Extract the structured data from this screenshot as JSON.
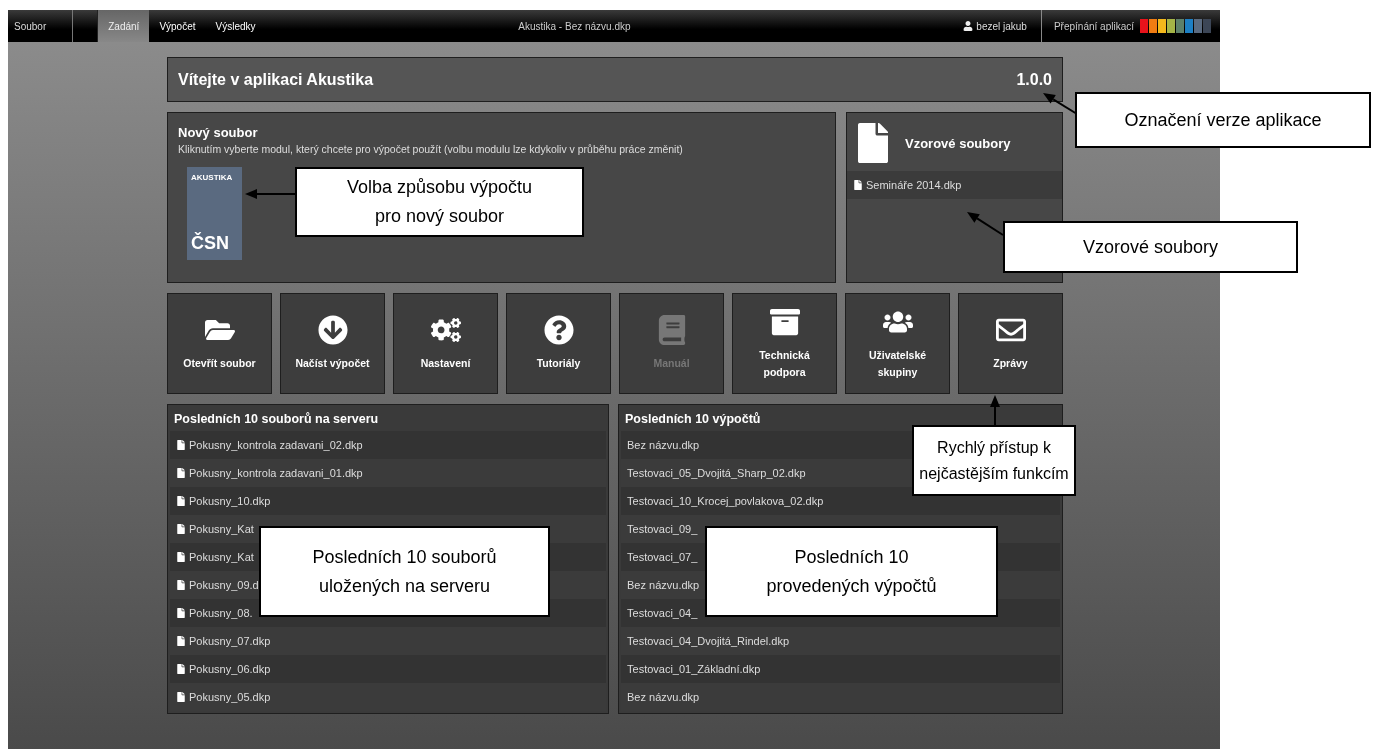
{
  "topbar": {
    "menu": "Soubor",
    "tabs": [
      {
        "label": "Zadání",
        "selected": true
      },
      {
        "label": "Výpočet",
        "selected": false
      },
      {
        "label": "Výsledky",
        "selected": false
      }
    ],
    "title": "Akustika - Bez názvu.dkp",
    "user": "bezel jakub",
    "app_switcher": {
      "label": "Přepínání aplikací"
    }
  },
  "welcome": {
    "title": "Vítejte v aplikaci Akustika",
    "version": "1.0.0"
  },
  "new_file": {
    "title": "Nový soubor",
    "description": "Kliknutím vyberte modul, který chcete pro výpočet použít (volbu modulu lze kdykoliv v průběhu práce změnit)",
    "modules": [
      {
        "label_top": "AKUSTIKA",
        "label_bottom": "ČSN"
      }
    ]
  },
  "samples": {
    "title": "Vzorové soubory",
    "files": [
      "Semináře 2014.dkp"
    ]
  },
  "quick_actions": [
    {
      "label": "Otevřít soubor",
      "disabled": false
    },
    {
      "label": "Načíst výpočet",
      "disabled": false
    },
    {
      "label": "Nastavení",
      "disabled": false
    },
    {
      "label": "Tutoriály",
      "disabled": false
    },
    {
      "label": "Manuál",
      "disabled": true
    },
    {
      "label": "Technická podpora",
      "disabled": false
    },
    {
      "label": "Uživatelské skupiny",
      "disabled": false
    },
    {
      "label": "Zprávy",
      "disabled": false
    }
  ],
  "recent_server": {
    "title": "Posledních 10 souborů na serveru",
    "files": [
      "Pokusny_kontrola zadavani_02.dkp",
      "Pokusny_kontrola zadavani_01.dkp",
      "Pokusny_10.dkp",
      "Pokusny_Kat",
      "Pokusny_Kat",
      "Pokusny_09.d",
      "Pokusny_08.",
      "Pokusny_07.dkp",
      "Pokusny_06.dkp",
      "Pokusny_05.dkp"
    ]
  },
  "recent_calcs": {
    "title": "Posledních 10 výpočtů",
    "files": [
      "Bez názvu.dkp",
      "Testovaci_05_Dvojitá_Sharp_02.dkp",
      "Testovaci_10_Krocej_povlakova_02.dkp",
      "Testovaci_09_",
      "Testovaci_07_",
      "Bez názvu.dkp",
      "Testovaci_04_",
      "Testovaci_04_Dvojitá_Rindel.dkp",
      "Testovaci_01_Základní.dkp",
      "Bez názvu.dkp"
    ]
  },
  "callouts": [
    {
      "text": "Označení verze aplikace"
    },
    {
      "text": "Volba způsobu výpočtu pro nový soubor"
    },
    {
      "text": "Vzorové soubory"
    },
    {
      "text": "Rychlý přístup k nejčastějším funkcím"
    },
    {
      "text": "Posledních 10 souborů uložených na serveru"
    },
    {
      "text": "Posledních 10 provedených výpočtů"
    }
  ]
}
